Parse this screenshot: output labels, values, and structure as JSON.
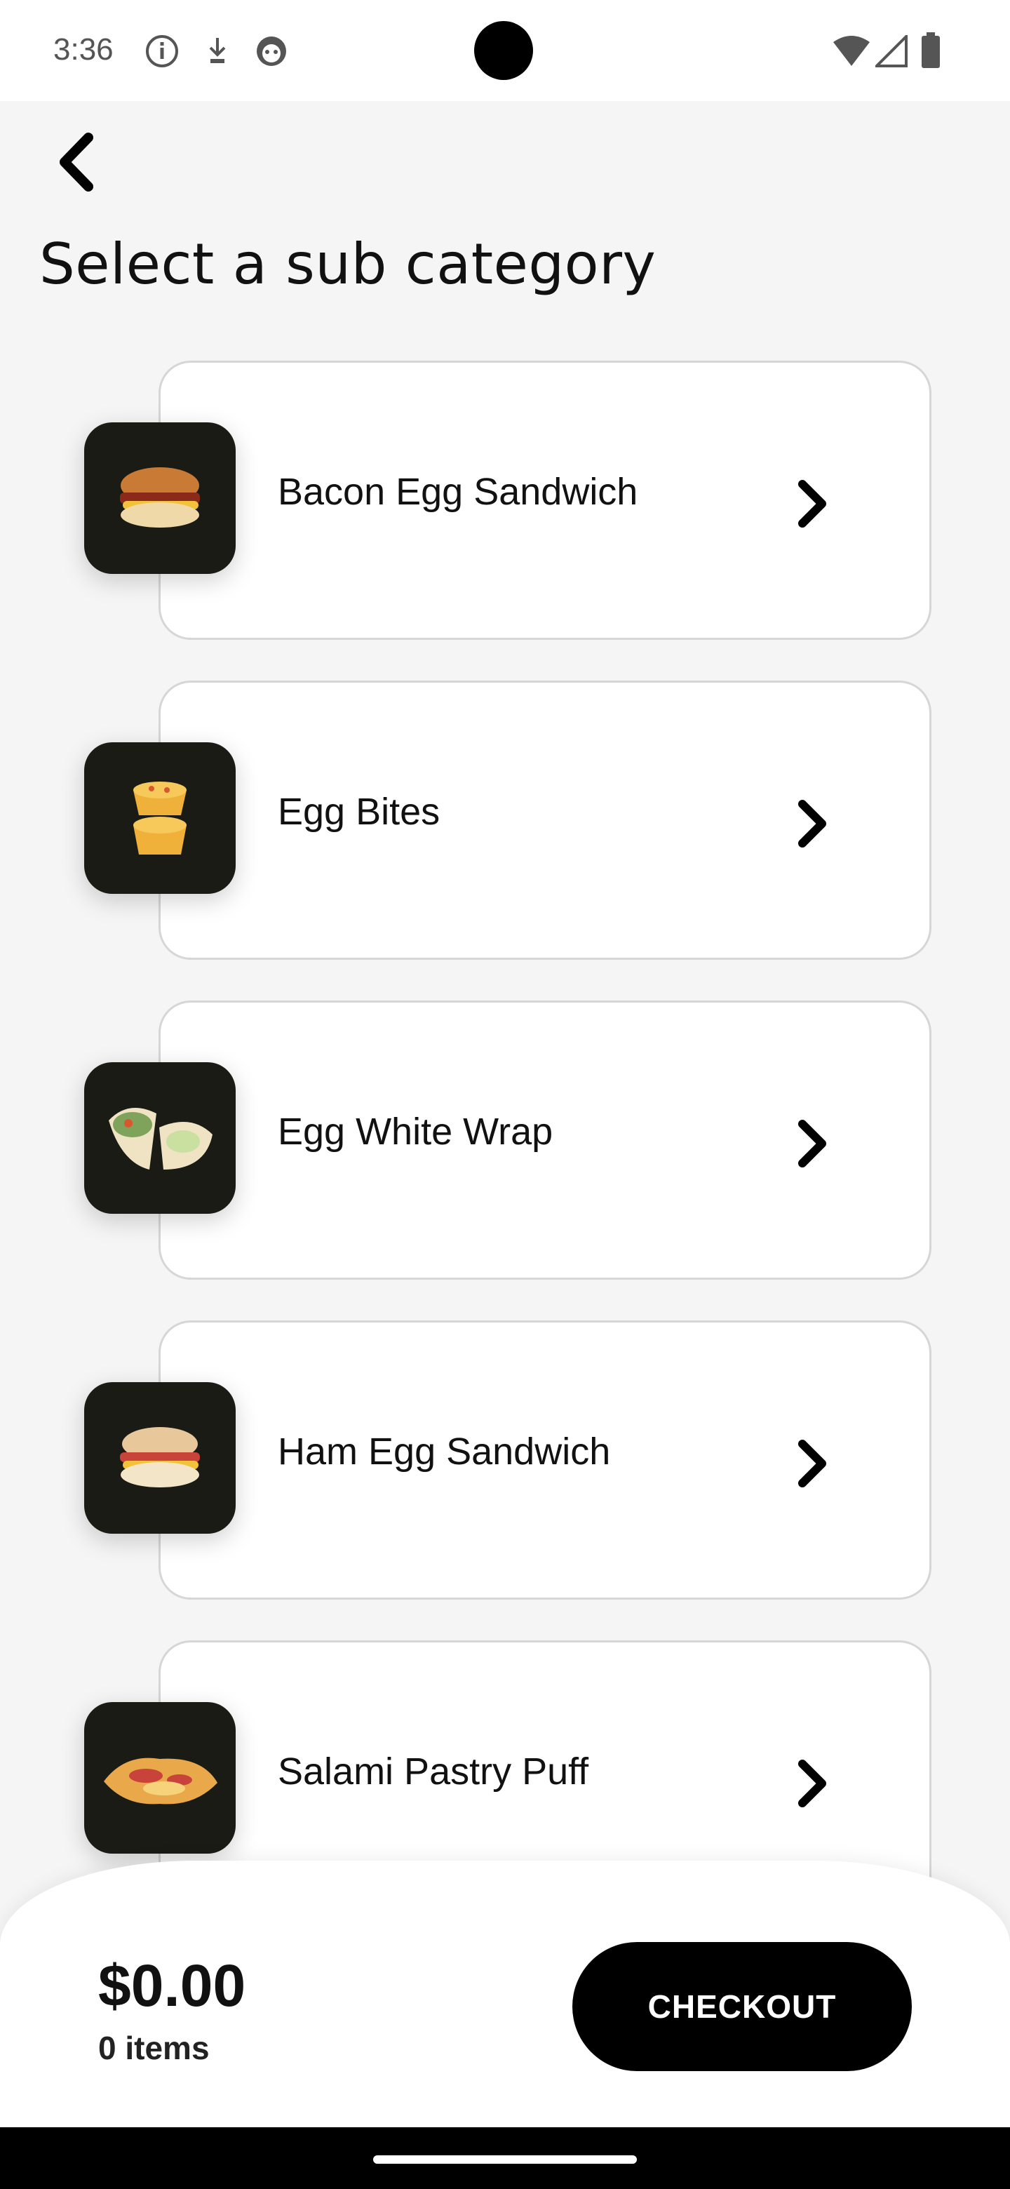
{
  "status_bar": {
    "time": "3:36",
    "left_icons": [
      "info-icon",
      "download-icon",
      "app-face-icon"
    ],
    "right_icons": [
      "wifi-icon",
      "signal-icon",
      "battery-icon"
    ]
  },
  "header": {
    "back_icon": "chevron-left-icon",
    "title": "Select a sub category"
  },
  "subcategories": [
    {
      "label": "Bacon Egg Sandwich",
      "thumb": "sandwich-image"
    },
    {
      "label": "Egg Bites",
      "thumb": "egg-bites-image"
    },
    {
      "label": "Egg White Wrap",
      "thumb": "wrap-image"
    },
    {
      "label": "Ham Egg Sandwich",
      "thumb": "sandwich-image"
    },
    {
      "label": "Salami Pastry Puff",
      "thumb": "pastry-image"
    }
  ],
  "cart": {
    "total": "$0.00",
    "items": "0 items",
    "checkout_label": "CHECKOUT"
  },
  "colors": {
    "background": "#f5f5f5",
    "card": "#ffffff",
    "thumb_bg": "#1b1b16",
    "button": "#000000"
  }
}
